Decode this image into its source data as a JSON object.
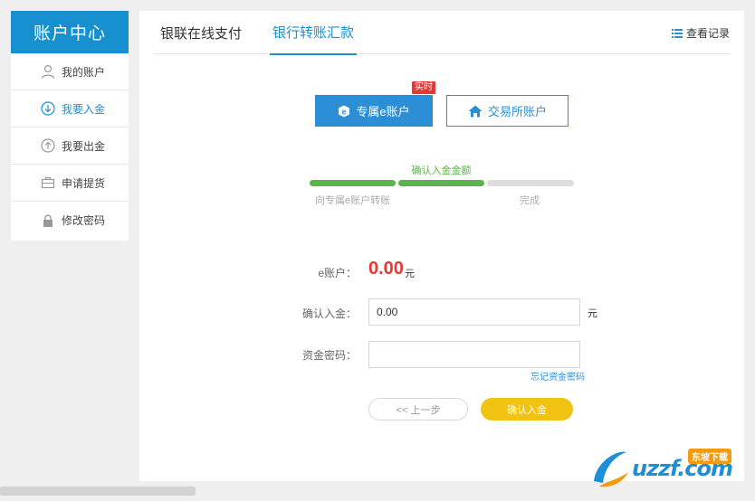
{
  "sidebar": {
    "title": "账户中心",
    "items": [
      {
        "label": "我的账户"
      },
      {
        "label": "我要入金"
      },
      {
        "label": "我要出金"
      },
      {
        "label": "申请提货"
      },
      {
        "label": "修改密码"
      }
    ]
  },
  "tabs": [
    {
      "label": "银联在线支付"
    },
    {
      "label": "银行转账汇款"
    }
  ],
  "record_link": "查看记录",
  "account_buttons": {
    "primary": "专属e账户",
    "secondary": "交易所账户",
    "badge": "实时"
  },
  "steps": {
    "current_label": "确认入金金额",
    "step1": "向专属e账户转账",
    "step3": "完成"
  },
  "form": {
    "balance_label": "e账户：",
    "balance_value": "0.00",
    "balance_unit": "元",
    "amount_label": "确认入金：",
    "amount_value": "0.00",
    "amount_unit": "元",
    "password_label": "资金密码：",
    "password_value": "",
    "forgot_link": "忘记资金密码"
  },
  "buttons": {
    "prev": "<< 上一步",
    "confirm": "确认入金"
  },
  "watermark": {
    "text": "uzzf.com",
    "badge": "东坡下载"
  },
  "colors": {
    "accent": "#1790d0",
    "progress_done": "#58b44b",
    "amount_red": "#e53935",
    "confirm_yellow": "#f0c312"
  }
}
